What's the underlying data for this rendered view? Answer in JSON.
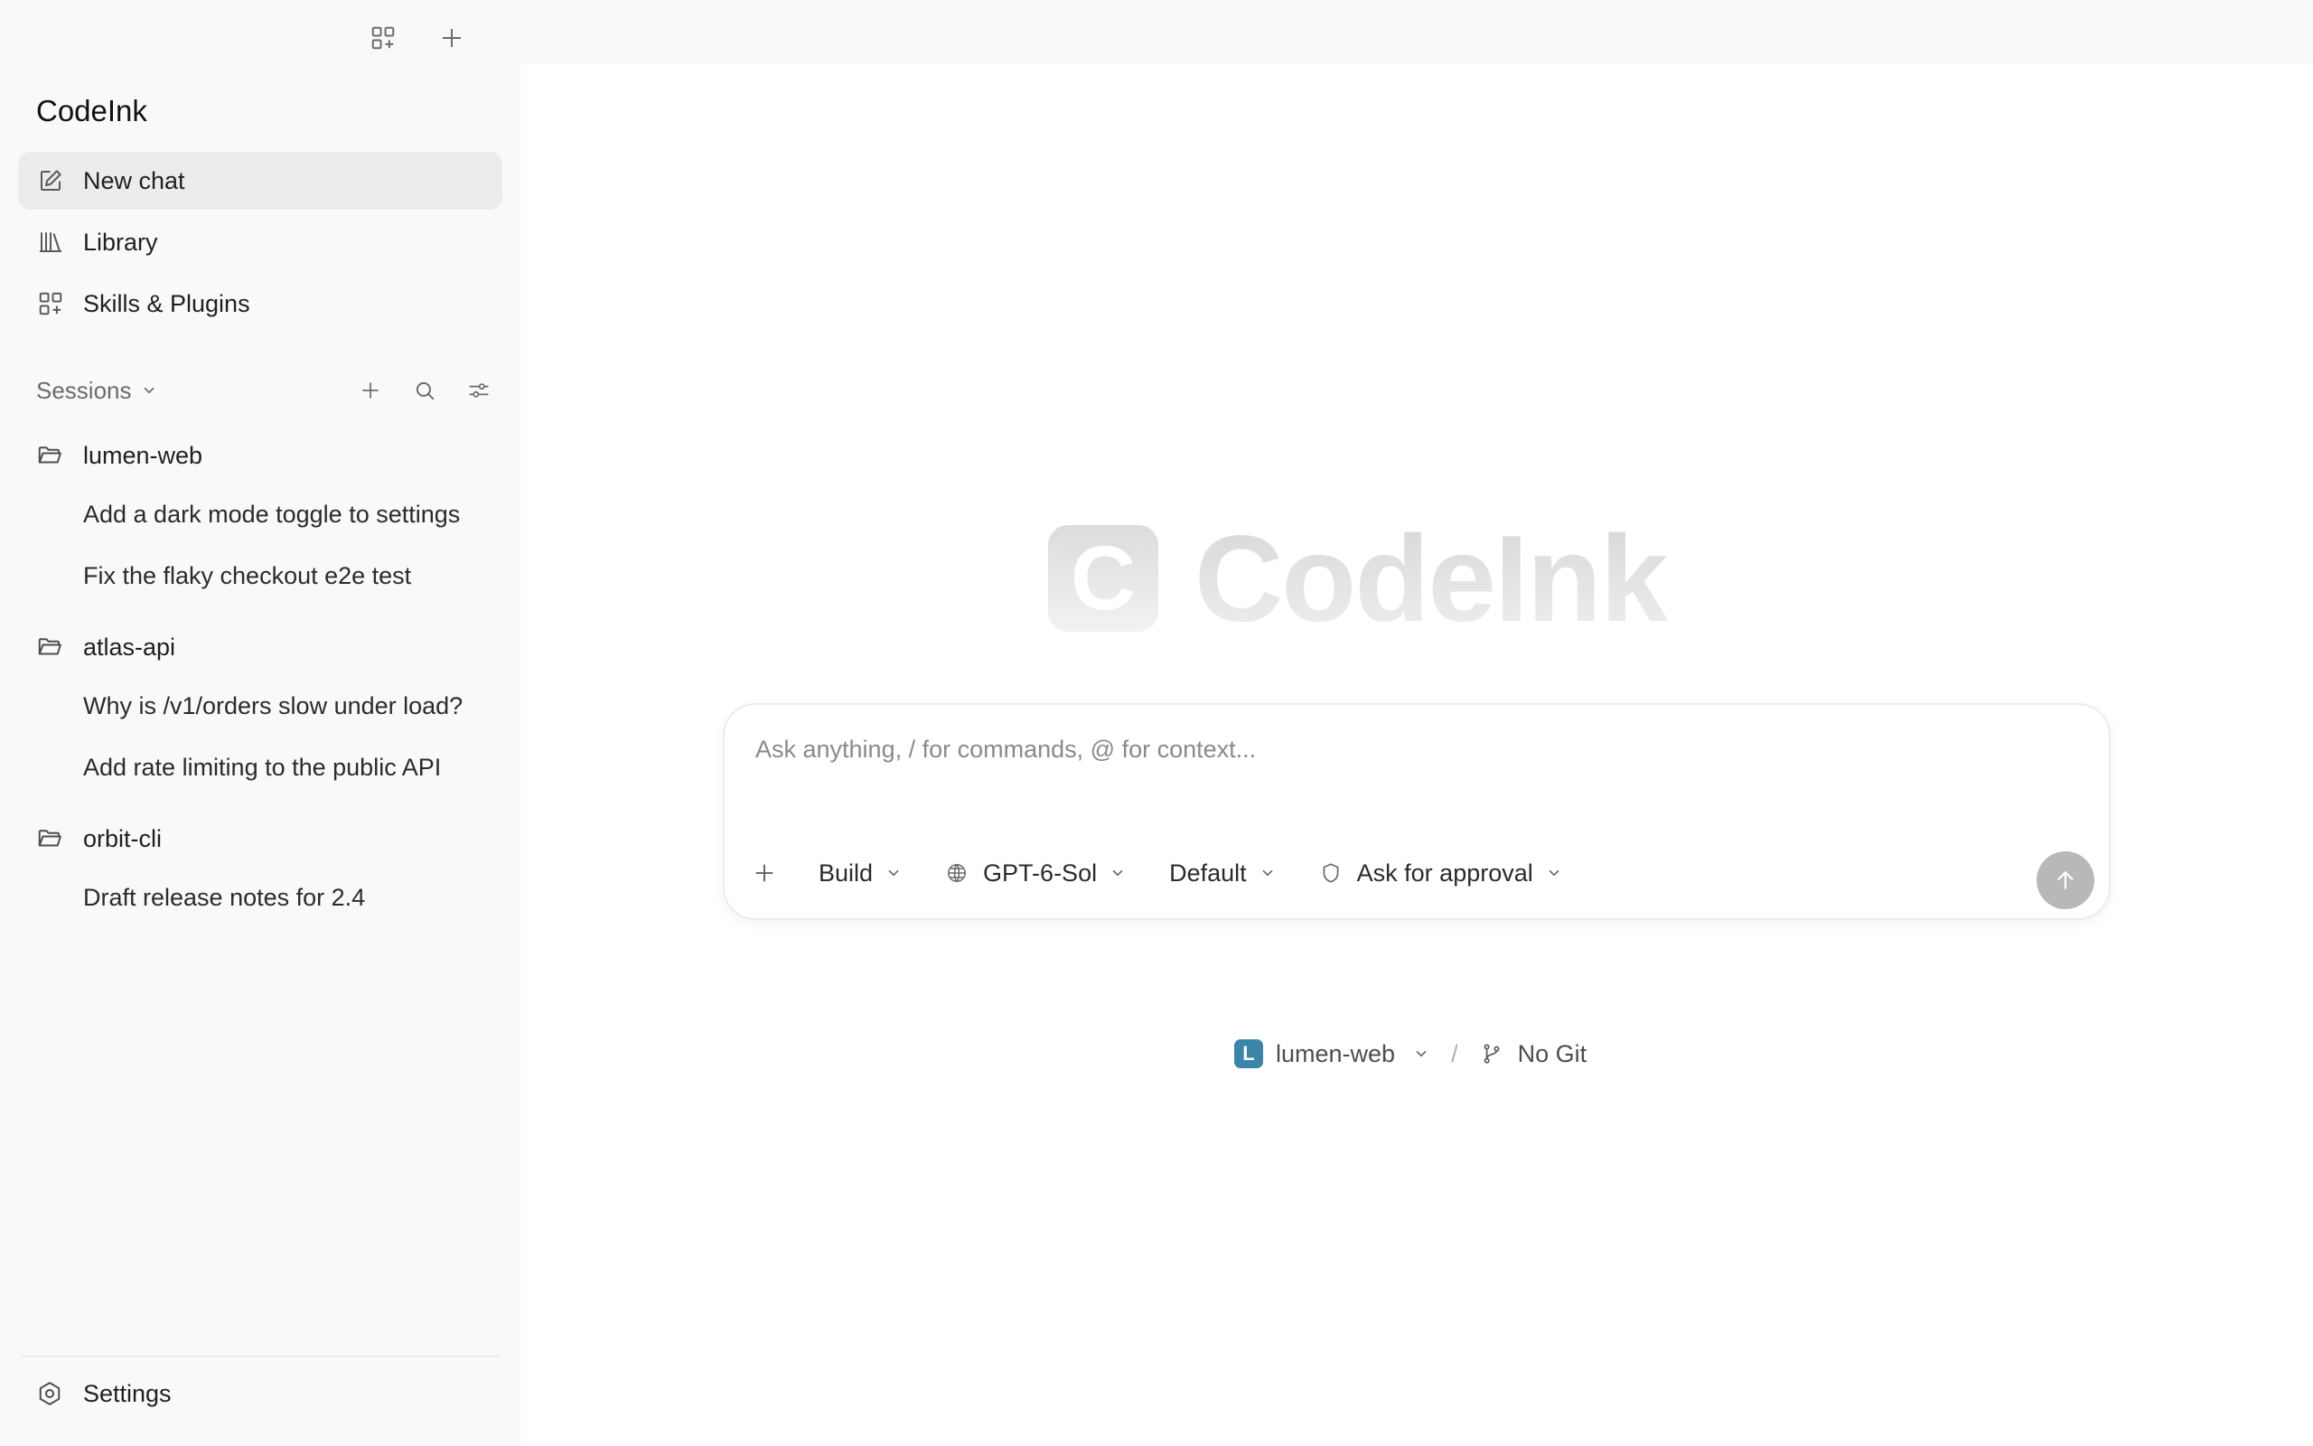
{
  "app": {
    "title": "CodeInk",
    "hero_mark": "C",
    "hero_word": "CodeInk"
  },
  "topbar": {
    "icons": [
      "grid-plus-icon",
      "plus-icon"
    ]
  },
  "nav": {
    "items": [
      {
        "label": "New chat",
        "icon": "edit-icon",
        "active": true
      },
      {
        "label": "Library",
        "icon": "library-icon",
        "active": false
      },
      {
        "label": "Skills & Plugins",
        "icon": "grid-plus-icon",
        "active": false
      }
    ]
  },
  "sessions": {
    "label": "Sessions",
    "projects": [
      {
        "name": "lumen-web",
        "chats": [
          "Add a dark mode toggle to settings",
          "Fix the flaky checkout e2e test"
        ]
      },
      {
        "name": "atlas-api",
        "chats": [
          "Why is /v1/orders slow under load?",
          "Add rate limiting to the public API"
        ]
      },
      {
        "name": "orbit-cli",
        "chats": [
          "Draft release notes for 2.4"
        ]
      }
    ]
  },
  "settings": {
    "label": "Settings"
  },
  "composer": {
    "placeholder": "Ask anything, / for commands, @ for context...",
    "mode": "Build",
    "model": "GPT-6-Sol",
    "profile": "Default",
    "approval": "Ask for approval"
  },
  "context": {
    "project_badge": "L",
    "project": "lumen-web",
    "separator": "/",
    "git": "No Git",
    "badge_color": "#3a86a8"
  }
}
